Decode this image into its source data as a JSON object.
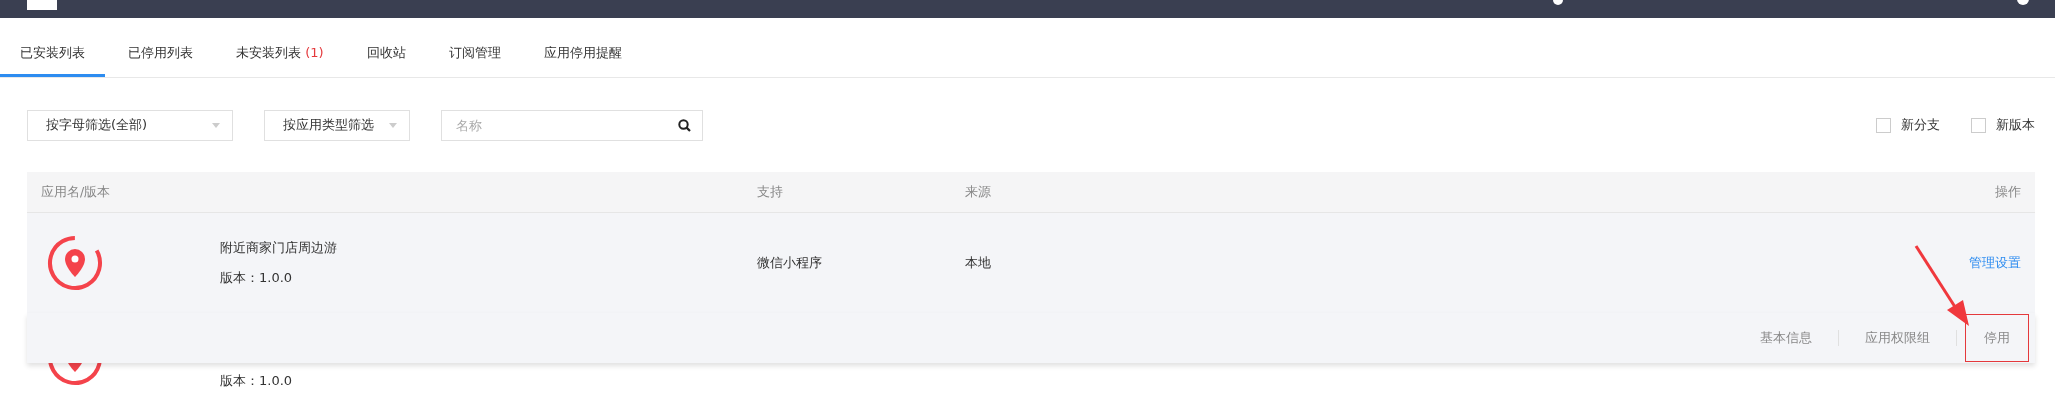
{
  "tabs": [
    {
      "label": "已安装列表",
      "selected": true
    },
    {
      "label": "已停用列表",
      "selected": false
    },
    {
      "label": "未安装列表",
      "count": "(1)",
      "selected": false
    },
    {
      "label": "回收站",
      "selected": false
    },
    {
      "label": "订阅管理",
      "selected": false
    },
    {
      "label": "应用停用提醒",
      "selected": false
    }
  ],
  "filters": {
    "letter": "按字母筛选(全部)",
    "type": "按应用类型筛选",
    "search_placeholder": "名称"
  },
  "options": [
    {
      "label": "新分支",
      "checked": false
    },
    {
      "label": "新版本",
      "checked": false
    }
  ],
  "table": {
    "columns": [
      "应用名/版本",
      "支持",
      "来源",
      "操作"
    ],
    "rows": [
      {
        "name": "附近商家门店周边游",
        "version": "版本：1.0.0",
        "support": "微信小程序",
        "source": "本地",
        "action": "管理设置",
        "hovered": true
      },
      {
        "version": "版本：1.0.0",
        "hovered": false
      }
    ]
  },
  "action_menu": {
    "items": [
      {
        "label": "基本信息",
        "highlighted": false
      },
      {
        "label": "应用权限组",
        "highlighted": false
      },
      {
        "label": "停用",
        "highlighted": true
      }
    ]
  }
}
